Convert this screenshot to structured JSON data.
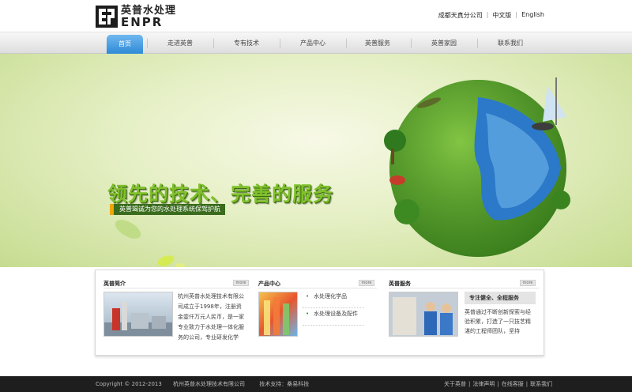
{
  "brand": {
    "cn_name": "英普水处理",
    "en_name": "ENPR"
  },
  "top_links": [
    "成都天真分公司",
    "中文版",
    "English"
  ],
  "nav": {
    "items": [
      "首页",
      "走进英普",
      "专有技术",
      "产品中心",
      "英普服务",
      "英普家园",
      "联系我们"
    ],
    "active": "首页"
  },
  "banner": {
    "slogan": "领先的技术、完善的服务",
    "subslogan": "英普竭诚为您的水处理系统保驾护航"
  },
  "about": {
    "title": "英普简介",
    "more": "more",
    "text": "杭州英普水处理技术有限公司成立于1998年，注册资金壹仟万元人民币，是一家专业致力于水处理一体化服务的公司，专业研发化学"
  },
  "products": {
    "title": "产品中心",
    "more": "more",
    "items": [
      "水处理化学品",
      "水处理设备及配件"
    ]
  },
  "service": {
    "title": "英普服务",
    "more": "more",
    "heading": "专注健全、全程服务",
    "text": "英普通过不断创新探索与经验积累，打造了一只技艺精湛的工程师团队，坚持"
  },
  "footer": {
    "copyright": "Copyright © 2012-2013",
    "company": "杭州英普水处理技术有限公司",
    "support": "技术支持：桑易科技",
    "links": [
      "关于英普",
      "法律声明",
      "在线客服",
      "联系我们"
    ]
  }
}
